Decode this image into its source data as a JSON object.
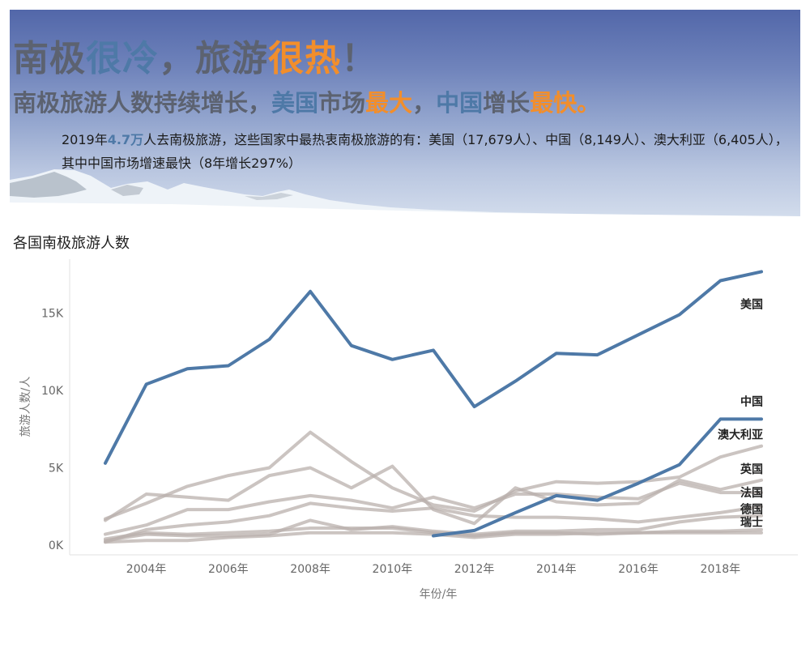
{
  "header": {
    "headline": {
      "p1": "南极",
      "p2": "很冷",
      "p3": "，旅游",
      "p4": "很热",
      "p5": "！"
    },
    "subhead": {
      "p1": "南极旅游人数持续增长，",
      "p2": "美国",
      "p3": "市场",
      "p4": "最大",
      "p5": "，",
      "p6": "中国",
      "p7": "增长",
      "p8": "最快",
      "p9": "。"
    },
    "description": {
      "p1": "2019年",
      "p2": "4.7万",
      "p3": "人去南极旅游，这些国家中最热衷南极旅游的有：美国（17,679人）、中国（8,149人）、澳大利亚（6,405人），其中中国市场增速最快（8年增长297%）"
    }
  },
  "chart_title": "各国南极旅游人数",
  "colors": {
    "highlight": "#4e79a7",
    "others": "#bab0ac",
    "accent": "#f28e2b"
  },
  "chart_data": {
    "type": "line",
    "xlabel": "年份/年",
    "ylabel": "旅游人数/人",
    "xlim": [
      2003,
      2019
    ],
    "ylim": [
      0,
      17700
    ],
    "x_ticks": [
      2004,
      2006,
      2008,
      2010,
      2012,
      2014,
      2016,
      2018
    ],
    "x_tick_labels": [
      "2004年",
      "2006年",
      "2008年",
      "2010年",
      "2012年",
      "2014年",
      "2016年",
      "2018年"
    ],
    "y_ticks": [
      0,
      5000,
      10000,
      15000
    ],
    "y_tick_labels": [
      "0K",
      "5K",
      "10K",
      "15K"
    ],
    "grid": false,
    "legend": "inline-right",
    "x": [
      2003,
      2004,
      2005,
      2006,
      2007,
      2008,
      2009,
      2010,
      2011,
      2012,
      2013,
      2014,
      2015,
      2016,
      2017,
      2018,
      2019
    ],
    "series": [
      {
        "name": "美国",
        "highlight": true,
        "values": [
          5300,
          10400,
          11400,
          11600,
          13300,
          16400,
          12900,
          12000,
          12600,
          8950,
          10600,
          12400,
          12300,
          13600,
          14900,
          17100,
          17679
        ]
      },
      {
        "name": "中国",
        "highlight": true,
        "values": [
          null,
          null,
          null,
          null,
          null,
          null,
          null,
          null,
          600,
          950,
          2100,
          3200,
          2900,
          4000,
          5200,
          8149,
          8149
        ]
      },
      {
        "name": "澳大利亚",
        "highlight": false,
        "values": [
          1700,
          2700,
          3800,
          4500,
          5000,
          7300,
          5400,
          3700,
          2600,
          2200,
          3500,
          4100,
          4000,
          4100,
          4400,
          5700,
          6405
        ]
      },
      {
        "name": "英国",
        "highlight": false,
        "values": [
          1600,
          3300,
          3100,
          2900,
          4500,
          5000,
          3700,
          5100,
          2300,
          1400,
          3700,
          2800,
          2600,
          2700,
          4200,
          3600,
          4200
        ]
      },
      {
        "name": "法国",
        "highlight": false,
        "values": [
          700,
          1300,
          2300,
          2300,
          2800,
          3200,
          2900,
          2400,
          3100,
          2400,
          3300,
          3300,
          3100,
          3000,
          4000,
          3400,
          3400
        ]
      },
      {
        "name": "德国",
        "highlight": false,
        "values": [
          200,
          1000,
          1300,
          1500,
          1900,
          2700,
          2400,
          2200,
          2400,
          1900,
          1800,
          1800,
          1700,
          1500,
          1800,
          2100,
          2500
        ]
      },
      {
        "name": "瑞士",
        "highlight": false,
        "values": [
          300,
          700,
          600,
          600,
          700,
          1600,
          1000,
          1200,
          900,
          700,
          900,
          900,
          1000,
          1000,
          1500,
          1800,
          1900
        ]
      },
      {
        "name": "",
        "highlight": false,
        "values": [
          400,
          800,
          700,
          800,
          900,
          1100,
          1100,
          1100,
          800,
          600,
          800,
          800,
          700,
          800,
          800,
          800,
          800
        ]
      },
      {
        "name": "",
        "highlight": false,
        "values": [
          200,
          300,
          300,
          500,
          600,
          800,
          800,
          800,
          700,
          500,
          700,
          700,
          800,
          800,
          900,
          900,
          1000
        ]
      }
    ]
  }
}
